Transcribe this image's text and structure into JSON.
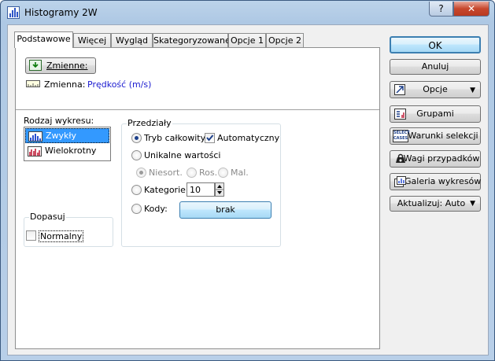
{
  "window": {
    "title": "Histogramy 2W",
    "help_label": "?",
    "close_label": "✕"
  },
  "tabs": [
    "Podstawowe",
    "Więcej",
    "Wygląd",
    "Skategoryzowane",
    "Opcje 1",
    "Opcje 2"
  ],
  "variables": {
    "button_label": "Zmienne:",
    "variable_caption": "Zmienna:",
    "variable_value": "Prędkość (m/s)"
  },
  "chart_type": {
    "legend": "Rodzaj wykresu:",
    "options": [
      "Zwykły",
      "Wielokrotny"
    ],
    "selected": "Zwykły"
  },
  "fit": {
    "legend": "Dopasuj",
    "normal_label": "Normalny",
    "normal_checked": false
  },
  "intervals": {
    "legend": "Przedziały",
    "full_mode_label": "Tryb całkowity",
    "automatic_label": "Automatyczny",
    "automatic_checked": true,
    "unique_label": "Unikalne wartości",
    "unsorted_label": "Niesort.",
    "ascending_label": "Ros.",
    "descending_label": "Mal.",
    "categories_label": "Kategorie:",
    "categories_value": "10",
    "codes_label": "Kody:",
    "codes_button": "brak"
  },
  "sidebar": {
    "ok": "OK",
    "cancel": "Anuluj",
    "options": "Opcje",
    "by_group": "Grupami",
    "select_cases": "Warunki selekcji",
    "select_icon_text_1": "SELECT",
    "select_icon_text_2": "CASES",
    "case_weights": "Wagi przypadków",
    "chart_gallery": "Galeria wykresów",
    "update": "Aktualizuj: Auto"
  },
  "colors": {
    "accent": "#1c3f8a",
    "selected_bg": "#3399ff",
    "link_blue": "#1b1bd0"
  }
}
